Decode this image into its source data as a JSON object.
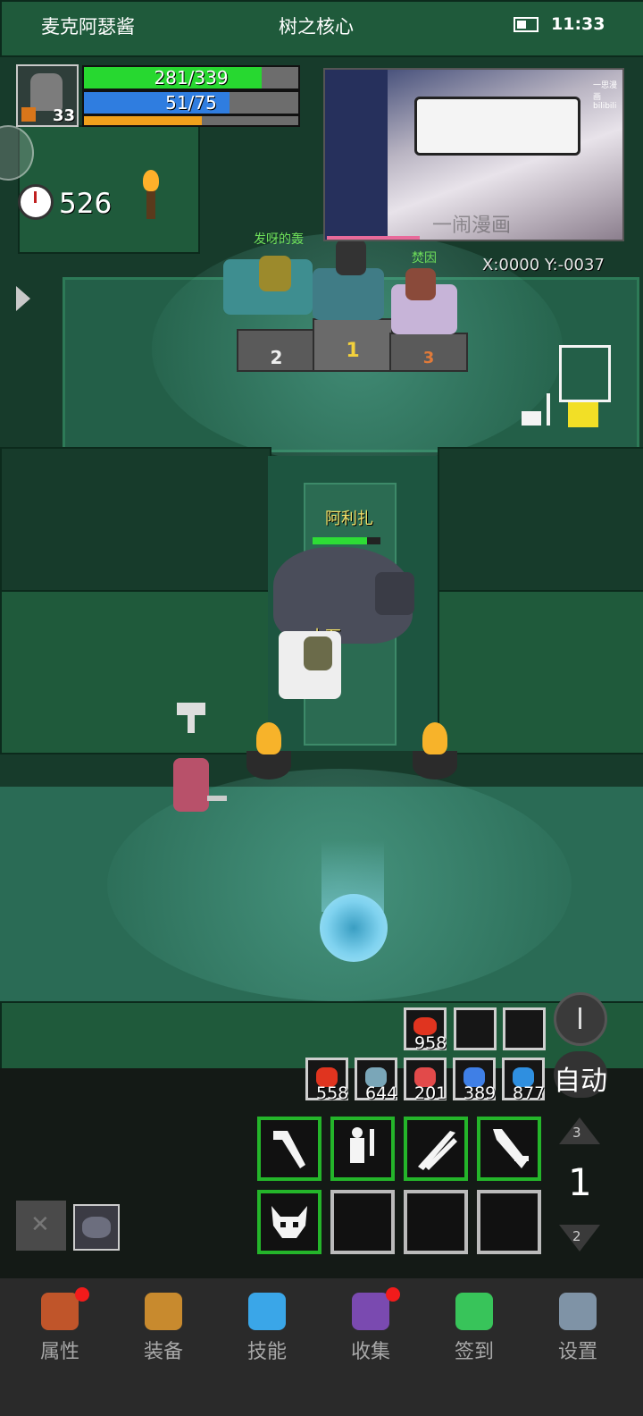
{
  "status_bar": {
    "left_title": "麦克阿瑟酱",
    "center_title": "树之核心",
    "time": "11:33"
  },
  "player": {
    "level": "33",
    "hp_text": "281/339",
    "hp_fraction": 0.829,
    "mp_text": "51/75",
    "mp_fraction": 0.68,
    "xp_fraction": 0.55
  },
  "timer": {
    "value": "526"
  },
  "coordinates": {
    "text": "X:0000  Y:-0037"
  },
  "video_overlay": {
    "watermark": "一闹漫画",
    "small_text": "一思漫画  bilibili"
  },
  "npc_names": {
    "second": "发呀的轰",
    "third": "焚因",
    "boss": "阿利扎",
    "companion": "小石"
  },
  "podium": {
    "first": "1",
    "second": "2",
    "third": "3"
  },
  "boss_hp_fraction": 0.8,
  "quick_item": {
    "count": "958"
  },
  "inventory": [
    {
      "name": "red-meat-icon",
      "count": "558"
    },
    {
      "name": "fish-icon",
      "count": "644"
    },
    {
      "name": "red-potion-icon",
      "count": "201"
    },
    {
      "name": "blue-potion-icon",
      "count": "389"
    },
    {
      "name": "blue-meat-icon",
      "count": "877"
    }
  ],
  "auto_button": {
    "label": "自动"
  },
  "skill_page": {
    "current": "1",
    "up": "3",
    "down": "2"
  },
  "nav": [
    {
      "label": "属性",
      "icon": "helmet-icon",
      "badge": true
    },
    {
      "label": "装备",
      "icon": "bag-icon",
      "badge": false
    },
    {
      "label": "技能",
      "icon": "crystal-icon",
      "badge": false
    },
    {
      "label": "收集",
      "icon": "monitor-icon",
      "badge": true
    },
    {
      "label": "签到",
      "icon": "gem-icon",
      "badge": false
    },
    {
      "label": "设置",
      "icon": "gear-icon",
      "badge": false
    }
  ],
  "colors": {
    "hp": "#27d830",
    "mp": "#2f7de0",
    "xp": "#f0a01c",
    "skill_border": "#24b52a",
    "nav_bg": "#2a2a2a",
    "badge": "#f21b1b"
  }
}
